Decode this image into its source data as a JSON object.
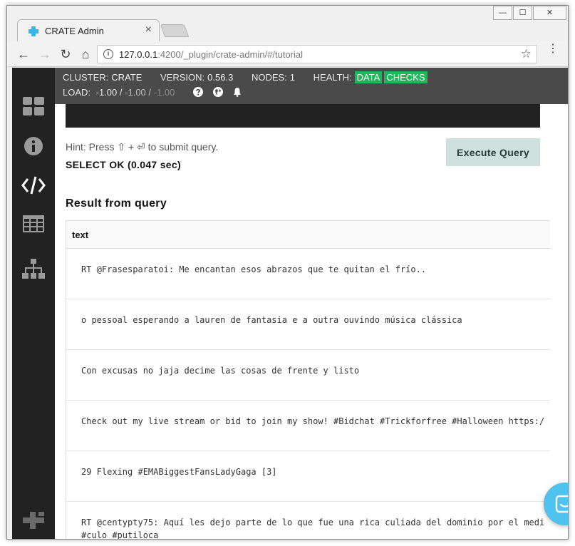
{
  "browser": {
    "tab_title": "CRATE Admin",
    "tab_close": "×",
    "window_controls": {
      "minimize": "—",
      "maximize": "☐",
      "close": "✕"
    },
    "nav": {
      "back": "←",
      "forward": "→",
      "reload": "↻",
      "home": "⌂"
    },
    "url_host": "127.0.0.1",
    "url_path": ":4200/_plugin/crate-admin/#/tutorial",
    "bookmark": "☆",
    "menu": "⋮"
  },
  "sidebar": {
    "items": [
      {
        "name": "overview",
        "icon": "grid-icon"
      },
      {
        "name": "information",
        "icon": "info-icon"
      },
      {
        "name": "console",
        "icon": "code-icon",
        "active": true
      },
      {
        "name": "tables",
        "icon": "table-icon"
      },
      {
        "name": "cluster",
        "icon": "hierarchy-icon"
      }
    ],
    "footer_icon": "crate-logo-icon"
  },
  "status": {
    "cluster_label": "CLUSTER:",
    "cluster_value": "CRATE",
    "version_label": "VERSION:",
    "version_value": "0.56.3",
    "nodes_label": "NODES:",
    "nodes_value": "1",
    "health_label": "HEALTH:",
    "health_data": "DATA",
    "health_checks": "CHECKS",
    "load_label": "LOAD:",
    "load_1": "-1.00",
    "load_sep": "/",
    "load_5": "-1.00",
    "load_15": "-1.00"
  },
  "console": {
    "hint": "Hint: Press ⇧ + ⏎ to submit query.",
    "result_status": "SELECT OK (0.047 sec)",
    "execute_label": "Execute Query",
    "result_title": "Result from query"
  },
  "result": {
    "columns": [
      "text"
    ],
    "rows": [
      "RT @Frasesparatoi: Me encantan esos abrazos que te quitan el frío..",
      "o pessoal esperando a lauren de fantasia e a outra ouvindo música clássica",
      "Con excusas no jaja decime las cosas de frente y listo",
      "Check out my live stream or bid to join my show! #Bidchat #Trickforfree #Halloween https:/",
      "29 Flexing #EMABiggestFansLadyGaga [3]",
      "RT @centypty75: Aquí les dejo parte de lo que fue una rica culiada del dominio por el medi",
      "#culo #putiloca"
    ]
  },
  "colors": {
    "sidebar_bg": "#222222",
    "statusbar_bg": "#4a4a4a",
    "health_green": "#1fb65a",
    "execute_bg": "#cfe0df",
    "chat_blue": "#4fc3f0"
  }
}
